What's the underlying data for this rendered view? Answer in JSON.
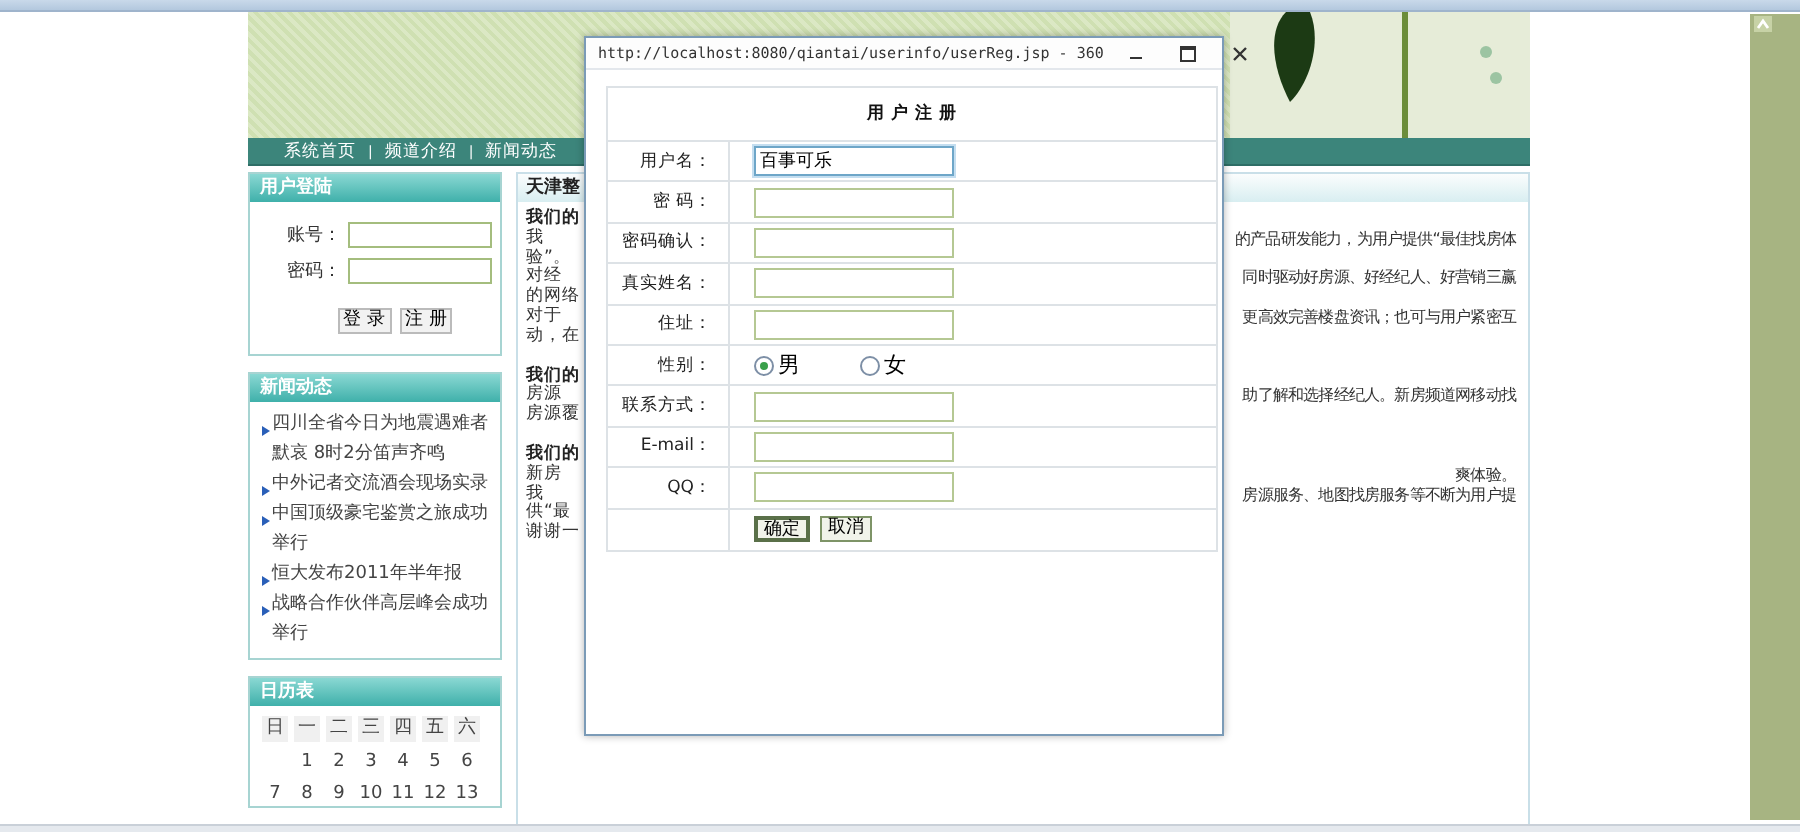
{
  "site": {
    "nav": [
      {
        "kind": "link",
        "text": "系统首页"
      },
      {
        "kind": "separator",
        "text": "|"
      },
      {
        "kind": "link",
        "text": "频道介绍"
      },
      {
        "kind": "separator",
        "text": "|"
      },
      {
        "kind": "link",
        "text": "新闻动态"
      }
    ],
    "login": {
      "title": "用户登陆",
      "fields": [
        {
          "label": "账号："
        },
        {
          "label": "密码："
        }
      ],
      "buttons": [
        "登 录",
        "注 册"
      ]
    },
    "news": {
      "title": "新闻动态",
      "items": [
        "四川全省今日为地震遇难者默哀 8时2分笛声齐鸣",
        "中外记者交流酒会现场实录",
        "中国顶级豪宅鉴赏之旅成功举行",
        "恒大发布2011年半年报",
        "战略合作伙伴高层峰会成功举行"
      ]
    },
    "calendar": {
      "title": "日历表",
      "weekdays": [
        "日",
        "一",
        "二",
        "三",
        "四",
        "五",
        "六"
      ],
      "weeks": [
        [
          "1",
          "2",
          "3",
          "4",
          "5",
          "6"
        ],
        [
          "7",
          "8",
          "9",
          "10",
          "11",
          "12",
          "13"
        ]
      ]
    },
    "content": {
      "title": "天津整",
      "sections": [
        {
          "heading": "我们的",
          "lines": [
            {
              "left": "我",
              "right": "的产品研发能力，为用户提供“最佳找房体"
            },
            {
              "left": "验”。"
            },
            {
              "left": "对经",
              "right": "同时驱动好房源、好经纪人、好营销三赢"
            },
            {
              "left": "的网络"
            },
            {
              "left": "对于",
              "right": "更高效完善楼盘资讯；也可与用户紧密互"
            },
            {
              "left": "动，在"
            }
          ]
        },
        {
          "heading": "我们的",
          "lines": [
            {
              "left": "房源",
              "right": "助了解和选择经纪人。新房频道网移动找"
            },
            {
              "left": "房源覆"
            }
          ]
        },
        {
          "heading": "我们的",
          "lines": [
            {
              "left": "新房",
              "right": "爽体验。"
            },
            {
              "left": "我",
              "right": "房源服务、地图找房服务等不断为用户提"
            },
            {
              "left": "供“最"
            },
            {
              "left": "谢谢一"
            }
          ]
        }
      ]
    }
  },
  "dialog": {
    "title": "http://localhost:8080/qiantai/userinfo/userReg.jsp - 360",
    "form_title": "用 户 注 册",
    "rows": [
      {
        "kind": "text",
        "label": "用户名：",
        "value": "百事可乐",
        "focused": true
      },
      {
        "kind": "text",
        "label": "密 码：",
        "focused": false
      },
      {
        "kind": "text",
        "label": "密码确认：",
        "focused": false
      },
      {
        "kind": "text",
        "label": "真实姓名：",
        "focused": false
      },
      {
        "kind": "text",
        "label": "住址：",
        "focused": false
      },
      {
        "kind": "radio",
        "label": "性别：",
        "options": [
          {
            "label": "男",
            "selected": true
          },
          {
            "label": "女",
            "selected": false
          }
        ]
      },
      {
        "kind": "text",
        "label": "联系方式：",
        "focused": false
      },
      {
        "kind": "text",
        "label": "E-mail：",
        "focused": false
      },
      {
        "kind": "text",
        "label": "QQ：",
        "focused": false
      }
    ],
    "buttons": [
      "确定",
      "取消"
    ]
  }
}
